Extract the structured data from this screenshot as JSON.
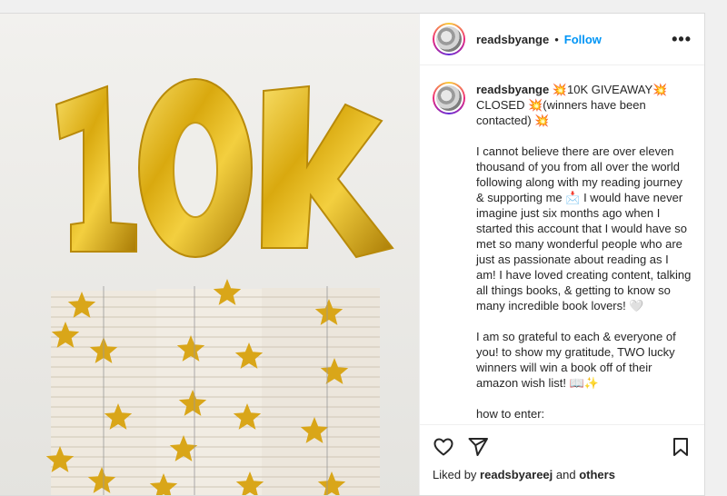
{
  "header": {
    "username": "readsbyange",
    "dot": "•",
    "follow_label": "Follow",
    "more_label": "•••"
  },
  "caption": {
    "username": "readsbyange",
    "line1": "💥10K GIVEAWAY💥 CLOSED 💥(winners have been contacted) 💥",
    "para1": "I cannot believe there are over eleven thousand of you from all over the world following along with my reading journey & supporting me 📩 I would have never imagine just six months ago when I started this account that I would have so met so many wonderful people who are just as passionate about reading as I am! I have loved creating content, talking all things books, & getting to know so many incredible book lovers! 🤍",
    "para2": "I am so grateful to each & everyone of you! to show my gratitude, TWO lucky winners will win a book off of their amazon wish list! 📖✨",
    "para3": "how to enter:"
  },
  "media": {
    "balloon_text": "10K",
    "balloon_color": "#e0b21f",
    "star_color": "#d9a619"
  },
  "actions": {
    "like_icon": "heart-icon",
    "share_icon": "paper-plane-icon",
    "save_icon": "bookmark-icon"
  },
  "likes": {
    "prefix": "Liked by ",
    "user": "readsbyareej",
    "middle": " and ",
    "others": "others"
  }
}
